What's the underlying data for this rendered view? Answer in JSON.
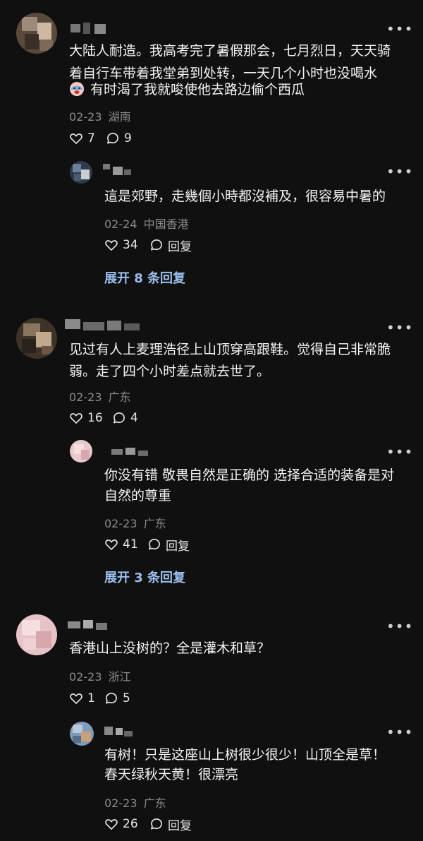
{
  "threads": [
    {
      "comment": {
        "lines": [
          "大陆人耐造。我高考完了暑假那会，七月烈日，天天骑",
          "着自行车带着我堂弟到处转，一天几个小时也没喝水",
          "有时渴了我就唆使他去路边偷个西瓜"
        ],
        "date": "02-23",
        "location": "湖南",
        "likes": "7",
        "replies": "9"
      },
      "reply": {
        "lines": [
          "這是郊野，走幾個小時都沒補及，很容易中暑的"
        ],
        "date": "02-24",
        "location": "中国香港",
        "likes": "34",
        "reply_label": "回复"
      },
      "expand_label": "展开 8 条回复"
    },
    {
      "comment": {
        "lines": [
          "见过有人上麦理浩径上山顶穿高跟鞋。觉得自己非常脆",
          "弱。走了四个小时差点就去世了。"
        ],
        "date": "02-23",
        "location": "广东",
        "likes": "16",
        "replies": "4"
      },
      "reply": {
        "lines": [
          "你没有错 敬畏自然是正确的 选择合适的装备是对",
          "自然的尊重"
        ],
        "date": "02-23",
        "location": "广东",
        "likes": "41",
        "reply_label": "回复"
      },
      "expand_label": "展开 3 条回复"
    },
    {
      "comment": {
        "lines": [
          "香港山上没树的？全是灌木和草？"
        ],
        "date": "02-23",
        "location": "浙江",
        "likes": "1",
        "replies": "5"
      },
      "reply": {
        "lines": [
          "有树！只是这座山上树很少很少！山顶全是草！",
          "春天绿秋天黄！很漂亮"
        ],
        "date": "02-23",
        "location": "广东",
        "likes": "26",
        "reply_label": "回复"
      }
    }
  ],
  "more_icon": "more-dots-icon",
  "like_icon": "heart-outline-icon",
  "reply_icon": "chat-bubble-icon",
  "inline_emoji": "crying-face-emoji",
  "colors": {
    "background": "#101010",
    "text": "#f4f4f4",
    "meta": "#8c8c8c",
    "expand_link": "#9ac0ee"
  }
}
